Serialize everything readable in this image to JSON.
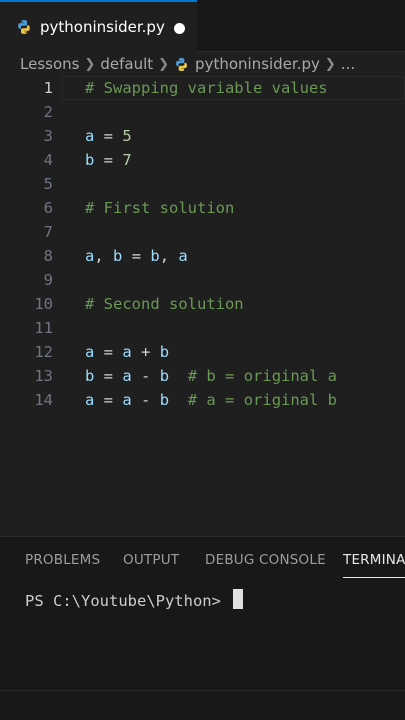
{
  "tab": {
    "label": "pythoninsider.py"
  },
  "breadcrumb": {
    "folder1": "Lessons",
    "folder2": "default",
    "file": "pythoninsider.py",
    "more": "..."
  },
  "editor": {
    "lines": [
      {
        "n": "1",
        "tokens": [
          {
            "t": "# Swapping variable values",
            "c": "com"
          }
        ]
      },
      {
        "n": "2",
        "tokens": []
      },
      {
        "n": "3",
        "tokens": [
          {
            "t": "a",
            "c": "var"
          },
          {
            "t": " = ",
            "c": "op"
          },
          {
            "t": "5",
            "c": "num"
          }
        ]
      },
      {
        "n": "4",
        "tokens": [
          {
            "t": "b",
            "c": "var"
          },
          {
            "t": " = ",
            "c": "op"
          },
          {
            "t": "7",
            "c": "num"
          }
        ]
      },
      {
        "n": "5",
        "tokens": []
      },
      {
        "n": "6",
        "tokens": [
          {
            "t": "# First solution",
            "c": "com"
          }
        ]
      },
      {
        "n": "7",
        "tokens": []
      },
      {
        "n": "8",
        "tokens": [
          {
            "t": "a",
            "c": "var"
          },
          {
            "t": ", ",
            "c": "op"
          },
          {
            "t": "b",
            "c": "var"
          },
          {
            "t": " = ",
            "c": "op"
          },
          {
            "t": "b",
            "c": "var"
          },
          {
            "t": ", ",
            "c": "op"
          },
          {
            "t": "a",
            "c": "var"
          }
        ]
      },
      {
        "n": "9",
        "tokens": []
      },
      {
        "n": "10",
        "tokens": [
          {
            "t": "# Second solution",
            "c": "com"
          }
        ]
      },
      {
        "n": "11",
        "tokens": []
      },
      {
        "n": "12",
        "tokens": [
          {
            "t": "a",
            "c": "var"
          },
          {
            "t": " = ",
            "c": "op"
          },
          {
            "t": "a",
            "c": "var"
          },
          {
            "t": " + ",
            "c": "op"
          },
          {
            "t": "b",
            "c": "var"
          }
        ]
      },
      {
        "n": "13",
        "tokens": [
          {
            "t": "b",
            "c": "var"
          },
          {
            "t": " = ",
            "c": "op"
          },
          {
            "t": "a",
            "c": "var"
          },
          {
            "t": " - ",
            "c": "op"
          },
          {
            "t": "b",
            "c": "var"
          },
          {
            "t": "  ",
            "c": "op"
          },
          {
            "t": "# b = original a",
            "c": "com"
          }
        ]
      },
      {
        "n": "14",
        "tokens": [
          {
            "t": "a",
            "c": "var"
          },
          {
            "t": " = ",
            "c": "op"
          },
          {
            "t": "a",
            "c": "var"
          },
          {
            "t": " - ",
            "c": "op"
          },
          {
            "t": "b",
            "c": "var"
          },
          {
            "t": "  ",
            "c": "op"
          },
          {
            "t": "# a = original b",
            "c": "com"
          }
        ]
      }
    ]
  },
  "panel": {
    "tabs": [
      "PROBLEMS",
      "OUTPUT",
      "DEBUG CONSOLE",
      "TERMINAL"
    ],
    "active_tab": "TERMINAL",
    "prompt": "PS C:\\Youtube\\Python> "
  },
  "colors": {
    "accent": "#0078d4",
    "comment": "#6a9955",
    "variable": "#9cdcfe",
    "number": "#b5cea8"
  },
  "icons": {
    "file": "python-icon"
  }
}
